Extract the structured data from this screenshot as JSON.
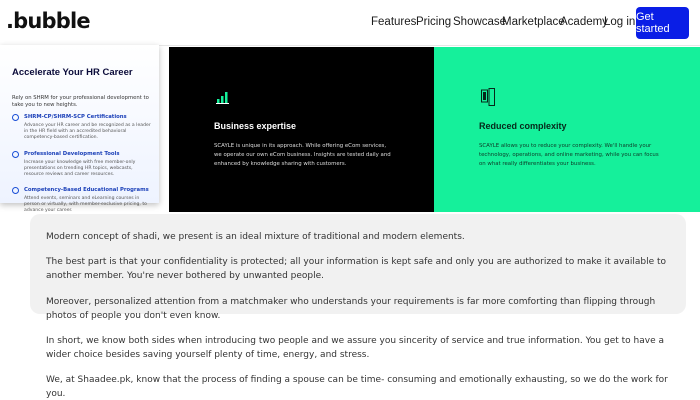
{
  "header": {
    "logo": ".bubble",
    "nav": [
      "Features",
      "Pricing",
      "Showcase",
      "Marketplace",
      "Academy"
    ],
    "login": "Log in",
    "cta": "Get started"
  },
  "popup": {
    "title": "Accelerate Your HR Career",
    "intro": "Rely on SHRM for your professional development to take you to new heights.",
    "programs": [
      {
        "title": "SHRM-CP/SHRM-SCP Certifications",
        "desc": "Advance your HR career and be recognized as a leader in the HR field with an accredited behavioral competency-based certification."
      },
      {
        "title": "Professional Development Tools",
        "desc": "Increase your knowledge with free member-only presentations on trending HR topics, webcasts, resource reviews and career resources."
      },
      {
        "title": "Competency-Based Educational Programs",
        "desc": "Attend events, seminars and eLearning courses in person or virtually, with member-exclusive pricing, to advance your career."
      }
    ]
  },
  "hero": {
    "business": {
      "icon": "bar-chart-icon",
      "title": "Business expertise",
      "text": "SCAYLE is unique in its approach. While offering eCom services, we operate our own eCom business. Insights are tested daily and enhanced by knowledge sharing with customers."
    },
    "complexity": {
      "icon": "device-icon",
      "title": "Reduced complexity",
      "text": "SCAYLE allows you to reduce your complexity. We'll handle your technology, operations, and online marketing, while you can focus on what really differentiates your business."
    }
  },
  "article": {
    "paragraphs": [
      "Modern concept of shadi, we present is an ideal mixture of traditional and modern elements.",
      "The best part is that your confidentiality is protected; all your information is kept safe and only you are authorized to make it available to another member. You're never bothered by unwanted people.",
      "Moreover, personalized attention from a matchmaker who understands your requirements is far more comforting than flipping through photos of people you don't even know.",
      "In short, we know both sides when introducing two people and we assure you sincerity of service and true information. You get to have a wider choice besides saving yourself plenty of time, energy, and stress.",
      "We, at Shaadee.pk, know that the process of finding a spouse can be time- consuming and emotionally exhausting, so we do the work for you."
    ]
  },
  "colors": {
    "cta": "#0a1ee6",
    "black_panel": "#000000",
    "green_panel": "#15f09b",
    "article_shade": "#f1f1f1"
  }
}
